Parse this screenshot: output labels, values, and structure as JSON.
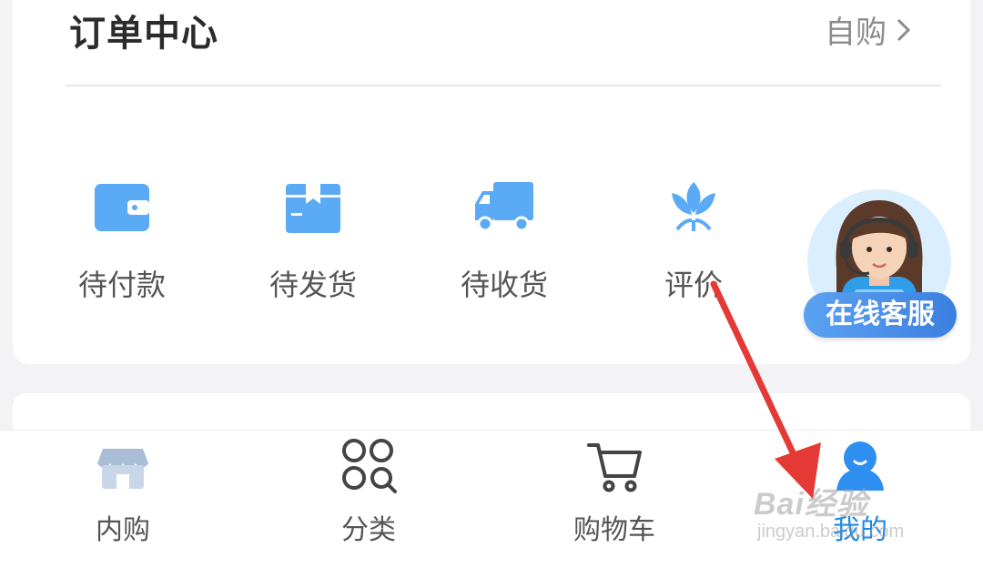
{
  "order_center": {
    "title": "订单中心",
    "more_label": "自购",
    "items": [
      {
        "label": "待付款",
        "icon": "wallet-icon"
      },
      {
        "label": "待发货",
        "icon": "package-icon"
      },
      {
        "label": "待收货",
        "icon": "truck-icon"
      },
      {
        "label": "评价",
        "icon": "lotus-icon"
      }
    ]
  },
  "customer_service": {
    "label": "在线客服",
    "icon": "customer-service-avatar"
  },
  "tabbar": {
    "items": [
      {
        "label": "内购",
        "icon": "store-icon"
      },
      {
        "label": "分类",
        "icon": "category-icon"
      },
      {
        "label": "购物车",
        "icon": "cart-icon"
      },
      {
        "label": "我的",
        "icon": "profile-icon",
        "active": true
      }
    ]
  },
  "watermark": {
    "main": "Bai经验",
    "sub": "jingyan.baidu.com"
  },
  "colors": {
    "accent": "#1e88e5",
    "icon_blue": "#5aaaf5",
    "annotation_arrow": "#e53935"
  }
}
